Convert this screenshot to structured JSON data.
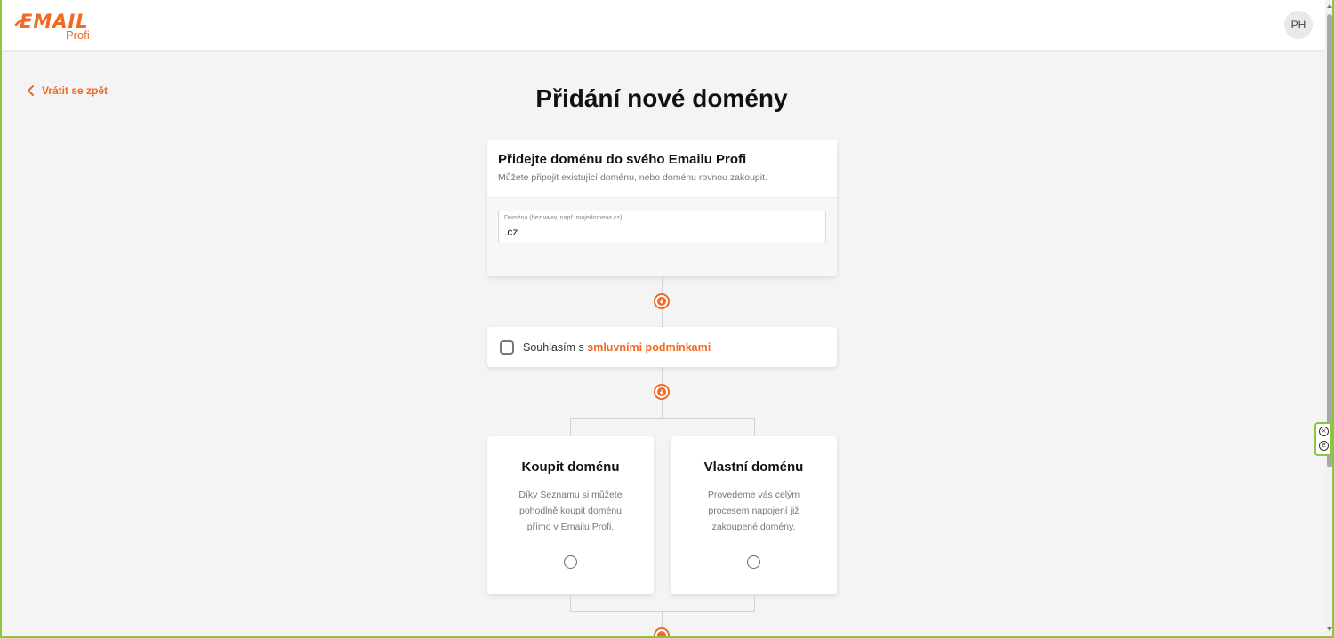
{
  "header": {
    "logo_text": "EMAIL",
    "logo_sub": "Profi",
    "avatar_initials": "PH"
  },
  "nav": {
    "back_label": "Vrátit se zpět"
  },
  "page": {
    "title": "Přidání nové domény"
  },
  "domain_card": {
    "heading": "Přidejte doménu do svého Emailu Profi",
    "description": "Můžete připojit existující doménu, nebo doménu rovnou zakoupit.",
    "field_label": "Doména (bez www, např. mojedomena.cz)",
    "field_value": ".cz"
  },
  "terms": {
    "prefix": "Souhlasím s ",
    "link": "smluvními podmínkami",
    "checked": false
  },
  "options": [
    {
      "title": "Koupit doménu",
      "description": "Díky Seznamu si můžete pohodlně koupit doménu přímo v Emailu Profi."
    },
    {
      "title": "Vlastní doménu",
      "description": "Provedeme vás celým procesem napojení již zakoupené domény."
    }
  ],
  "colors": {
    "accent": "#f26a21",
    "frame": "#8cc63f",
    "background": "#f4f4f4"
  }
}
